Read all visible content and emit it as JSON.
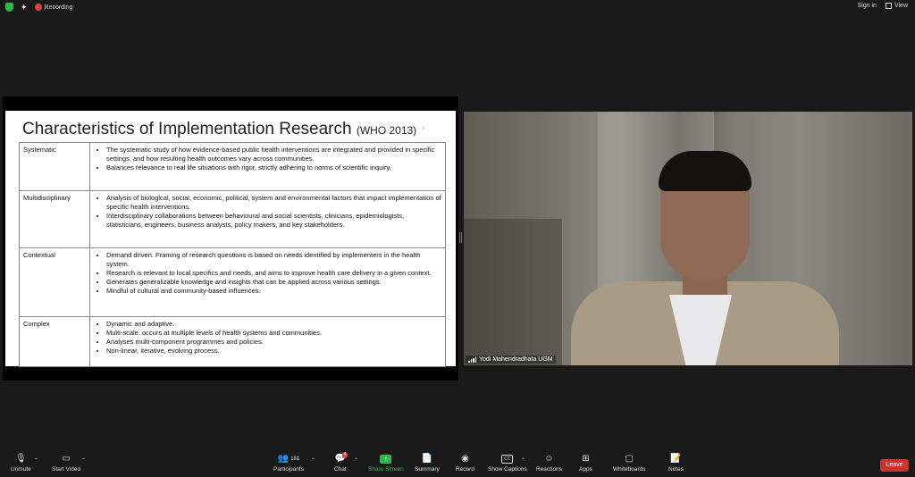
{
  "top_bar": {
    "recording_label": "Recording",
    "sign_in_label": "Sign in",
    "view_label": "View"
  },
  "slide": {
    "title": "Characteristics of Implementation Research",
    "subtitle": "(WHO 2013)",
    "rows": [
      {
        "category": "Systematic",
        "points": [
          "The systematic study of how evidence-based public health interventions are integrated and provided in specific settings, and how resulting health outcomes vary across communities.",
          "Balances relevance to real life situations with rigor, strictly adhering to norms of scientific inquiry."
        ]
      },
      {
        "category": "Multidisciplinary",
        "points": [
          "Analysis of biological, social, economic, political, system and environmental factors that impact implementation of specific health interventions.",
          "Interdisciplinary collaborations between behavioural and social scientists, clinicians, epidemiologists, statisticians, engineers, business analysts, policy makers, and key stakeholders."
        ]
      },
      {
        "category": "Contextual",
        "points": [
          "Demand driven. Framing of research questions is based on needs identified by implementers in the health system.",
          "Research is relevant to local specifics and needs, and aims to improve health care delivery in a given context.",
          "Generates generalizable knowledge and insights that can be applied across various settings.",
          "Mindful of cultural and community-based influences."
        ]
      },
      {
        "category": "Complex",
        "points": [
          "Dynamic and adaptive.",
          "Multi-scale: occurs at multiple levels of health systems and communities.",
          "Analyses multi-component programmes and policies.",
          "Non-linear, iterative, evolving process."
        ]
      }
    ]
  },
  "video": {
    "participant_name": "Yodi Mahendradhata UGM"
  },
  "toolbar": {
    "unmute_label": "Unmute",
    "start_video_label": "Start Video",
    "participants_label": "Participants",
    "participants_count": "181",
    "chat_label": "Chat",
    "chat_badge": "4",
    "share_screen_label": "Share Screen",
    "summary_label": "Summary",
    "record_label": "Record",
    "show_captions_label": "Show Captions",
    "cc_label": "CC",
    "reactions_label": "Reactions",
    "apps_label": "Apps",
    "whiteboards_label": "Whiteboards",
    "notes_label": "Notes",
    "leave_label": "Leave"
  },
  "colors": {
    "accent_green": "#2fb84d",
    "leave_red": "#c8362f",
    "background": "#1a1a1a"
  }
}
